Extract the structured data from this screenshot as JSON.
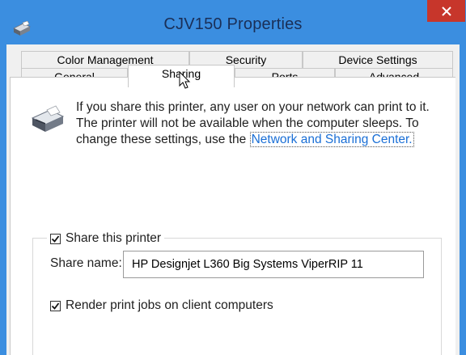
{
  "window": {
    "title": "CJV150 Properties",
    "close_icon": "close-icon",
    "app_icon": "printer-icon"
  },
  "tabs": {
    "row_back": [
      {
        "label": "Color Management"
      },
      {
        "label": "Security"
      },
      {
        "label": "Device Settings"
      }
    ],
    "row_front": [
      {
        "label": "General"
      },
      {
        "label": "Sharing",
        "active": true
      },
      {
        "label": "Ports"
      },
      {
        "label": "Advanced"
      }
    ]
  },
  "info": {
    "text": "If you share this printer, any user on your network can print to it. The printer will not be available when the computer sleeps. To change these settings, use the ",
    "link": "Network and Sharing Center."
  },
  "share": {
    "checkbox_label": "Share this printer",
    "checked": true,
    "name_label": "Share name:",
    "name_value": "HP Designjet L360 Big Systems ViperRIP 11",
    "render_label": "Render print jobs on client computers",
    "render_checked": true
  },
  "colors": {
    "titlebar": "#3b8ee0",
    "close": "#c7362b",
    "link": "#1a6fd6"
  }
}
